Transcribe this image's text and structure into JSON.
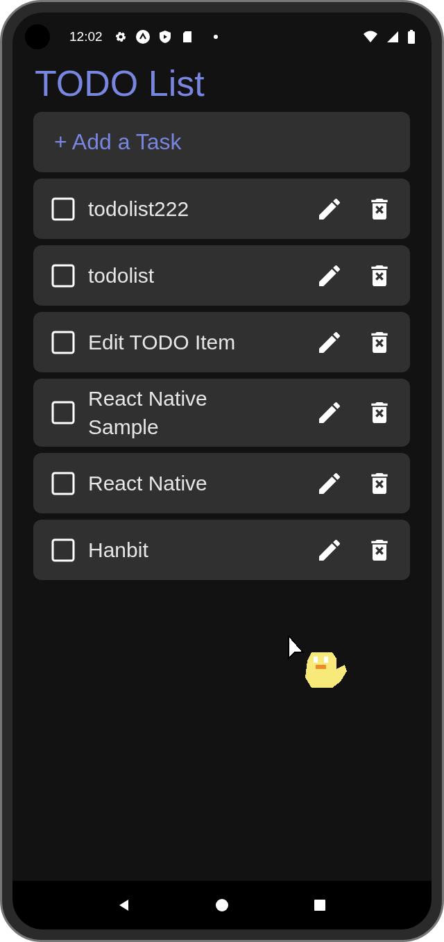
{
  "status_bar": {
    "time": "12:02"
  },
  "title": "TODO List",
  "add_button": {
    "label": "+ Add a Task"
  },
  "tasks": [
    {
      "text": "todolist222",
      "checked": false
    },
    {
      "text": "todolist",
      "checked": false
    },
    {
      "text": "Edit TODO Item",
      "checked": false
    },
    {
      "text": "React Native Sample",
      "checked": false
    },
    {
      "text": "React Native",
      "checked": false
    },
    {
      "text": "Hanbit",
      "checked": false
    }
  ]
}
